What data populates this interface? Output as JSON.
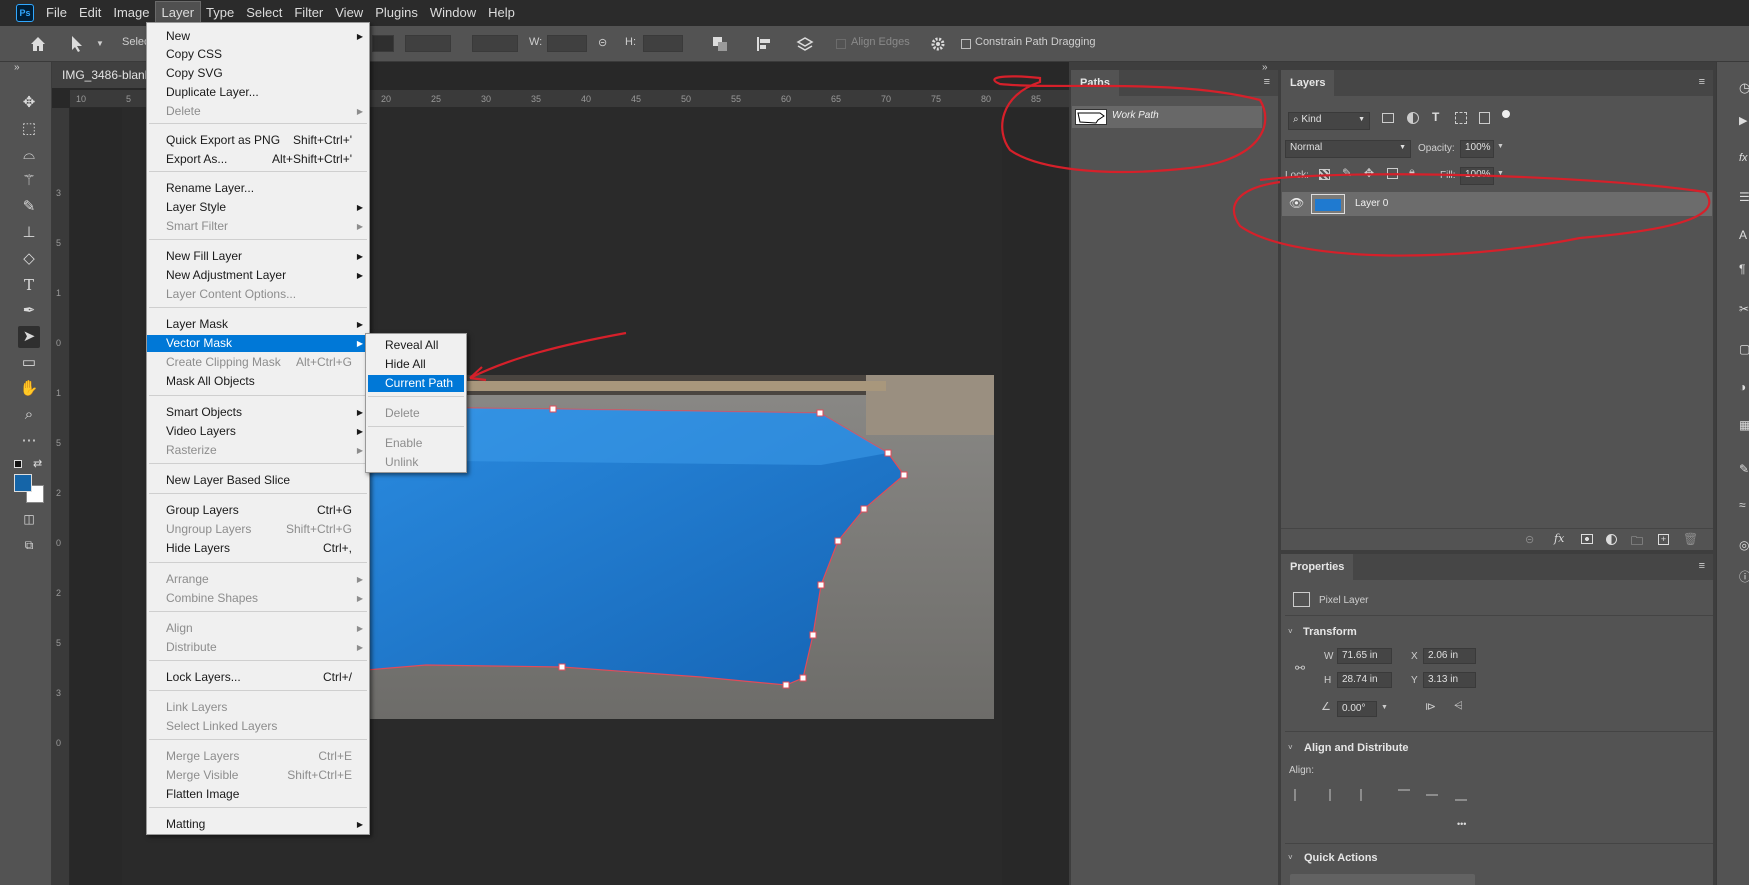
{
  "menubar": {
    "logo": "Ps",
    "items": [
      "File",
      "Edit",
      "Image",
      "Layer",
      "Type",
      "Select",
      "Filter",
      "View",
      "Plugins",
      "Window",
      "Help"
    ],
    "active_index": 3
  },
  "options_bar": {
    "select_label": "Selec",
    "w_label": "W:",
    "h_label": "H:",
    "align_edges": "Align Edges",
    "constrain": "Constrain Path Dragging"
  },
  "document": {
    "tab_title": "IMG_3486-blank",
    "ruler_top": [
      "10",
      "5",
      "20",
      "25",
      "30",
      "35",
      "40",
      "45",
      "50",
      "55",
      "60",
      "65",
      "70",
      "75",
      "80",
      "85"
    ],
    "ruler_left": [
      "3",
      "5",
      "1",
      "0",
      "1",
      "5",
      "2",
      "0",
      "2",
      "5",
      "3",
      "0",
      "3",
      "5",
      "4"
    ]
  },
  "layer_menu": {
    "items": [
      {
        "label": "New",
        "sub": true
      },
      {
        "label": "Copy CSS"
      },
      {
        "label": "Copy SVG"
      },
      {
        "label": "Duplicate Layer..."
      },
      {
        "label": "Delete",
        "disabled": true,
        "sub": true
      },
      {
        "label": "Quick Export as PNG",
        "shortcut": "Shift+Ctrl+'"
      },
      {
        "label": "Export As...",
        "shortcut": "Alt+Shift+Ctrl+'"
      },
      {
        "label": "Rename Layer..."
      },
      {
        "label": "Layer Style",
        "sub": true
      },
      {
        "label": "Smart Filter",
        "disabled": true,
        "sub": true
      },
      {
        "label": "New Fill Layer",
        "sub": true
      },
      {
        "label": "New Adjustment Layer",
        "sub": true
      },
      {
        "label": "Layer Content Options...",
        "disabled": true
      },
      {
        "label": "Layer Mask",
        "sub": true
      },
      {
        "label": "Vector Mask",
        "sub": true,
        "highlighted": true
      },
      {
        "label": "Create Clipping Mask",
        "shortcut": "Alt+Ctrl+G",
        "disabled": true
      },
      {
        "label": "Mask All Objects"
      },
      {
        "label": "Smart Objects",
        "sub": true
      },
      {
        "label": "Video Layers",
        "sub": true
      },
      {
        "label": "Rasterize",
        "disabled": true,
        "sub": true
      },
      {
        "label": "New Layer Based Slice"
      },
      {
        "label": "Group Layers",
        "shortcut": "Ctrl+G"
      },
      {
        "label": "Ungroup Layers",
        "shortcut": "Shift+Ctrl+G",
        "disabled": true
      },
      {
        "label": "Hide Layers",
        "shortcut": "Ctrl+,"
      },
      {
        "label": "Arrange",
        "disabled": true,
        "sub": true
      },
      {
        "label": "Combine Shapes",
        "disabled": true,
        "sub": true
      },
      {
        "label": "Align",
        "disabled": true,
        "sub": true
      },
      {
        "label": "Distribute",
        "disabled": true,
        "sub": true
      },
      {
        "label": "Lock Layers...",
        "shortcut": "Ctrl+/"
      },
      {
        "label": "Link Layers",
        "disabled": true
      },
      {
        "label": "Select Linked Layers",
        "disabled": true
      },
      {
        "label": "Merge Layers",
        "shortcut": "Ctrl+E",
        "disabled": true
      },
      {
        "label": "Merge Visible",
        "shortcut": "Shift+Ctrl+E",
        "disabled": true
      },
      {
        "label": "Flatten Image"
      },
      {
        "label": "Matting",
        "sub": true
      }
    ]
  },
  "vector_mask_submenu": {
    "items": [
      {
        "label": "Reveal All"
      },
      {
        "label": "Hide All"
      },
      {
        "label": "Current Path",
        "highlighted": true
      },
      {
        "label": "Delete",
        "disabled": true
      },
      {
        "label": "Enable",
        "disabled": true
      },
      {
        "label": "Unlink",
        "disabled": true
      }
    ]
  },
  "paths_panel": {
    "tab": "Paths",
    "work_path": "Work Path"
  },
  "layers_panel": {
    "tab": "Layers",
    "filter": "Kind",
    "blend_mode": "Normal",
    "opacity_label": "Opacity:",
    "opacity_value": "100%",
    "lock_label": "Lock:",
    "fill_label": "Fill:",
    "fill_value": "100%",
    "layer_name": "Layer 0"
  },
  "properties_panel": {
    "tab": "Properties",
    "kind": "Pixel Layer",
    "transform_title": "Transform",
    "w_label": "W",
    "w_value": "71.65 in",
    "x_label": "X",
    "x_value": "2.06 in",
    "h_label": "H",
    "h_value": "28.74 in",
    "y_label": "Y",
    "y_value": "3.13 in",
    "angle_value": "0.00°",
    "align_title": "Align and Distribute",
    "align_label": "Align:",
    "more": "•••",
    "quick_actions_title": "Quick Actions"
  },
  "colors": {
    "accent": "#0078d7",
    "annotation": "#d6202a",
    "tablecloth": "#1f7ad0"
  }
}
